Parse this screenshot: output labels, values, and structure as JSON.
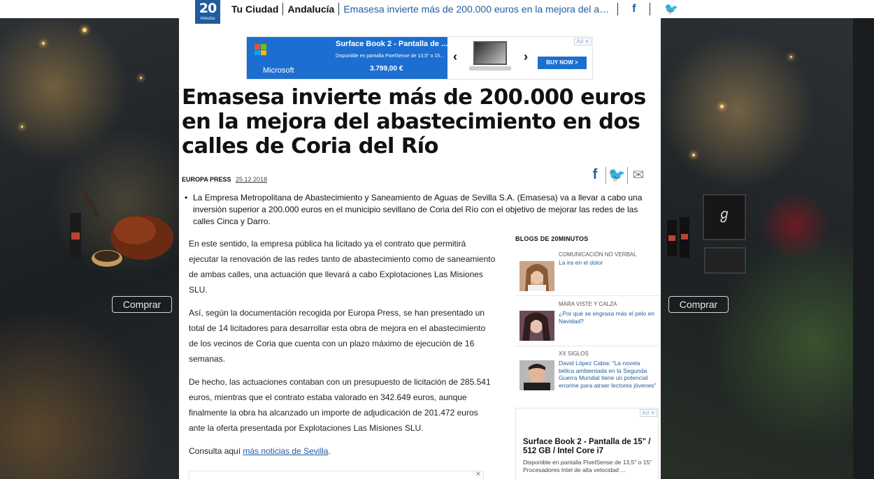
{
  "topbar": {
    "logo_number": "20",
    "logo_word": "minutos",
    "section": "Tu Ciudad",
    "subsection": "Andalucía",
    "article_title_short": "Emasesa invierte más de 200.000 euros en la mejora del a…",
    "facebook_glyph": "f",
    "twitter_glyph": "🐦"
  },
  "top_ad": {
    "brand": "Microsoft",
    "title": "Surface Book 2 - Pantalla de ...",
    "subtitle": "Disponible en pantalla PixelSense de 13,5\" o 15...",
    "price": "3.799,00 €",
    "cta": "BUY NOW >",
    "prev": "‹",
    "next": "›",
    "adchoice": "Ad ✕",
    "colors": {
      "blue": "#1c6fd1"
    }
  },
  "article": {
    "headline": "Emasesa invierte más de 200.000 euros en la mejora del abastecimiento en dos calles de Coria del Río",
    "source": "EUROPA PRESS",
    "date": "25.12.2018",
    "summary": "La Empresa Metropolitana de Abastecimiento y Saneamiento de Aguas de Sevilla S.A. (Emasesa) va a llevar a cabo una inversión superior a 200.000 euros en el municipio sevillano de Coria del Río con el objetivo de mejorar las redes de las calles Cinca y Darro.",
    "bullet": "•",
    "paragraphs": [
      "En este sentido, la empresa pública ha licitado ya el contrato que permitirá ejecutar la renovación de las redes tanto de abastecimiento como de saneamiento de ambas calles, una actuación que llevará a cabo Explotaciones Las Misiones SLU.",
      "Así, según la documentación recogida por Europa Press, se han presentado un total de 14 licitadores para desarrollar esta obra de mejora en el abastecimiento de los vecinos de Coria que cuenta con un plazo máximo de ejecución de 16 semanas.",
      "De hecho, las actuaciones contaban con un presupuesto de licitación de 285.541 euros, mientras que el contrato estaba valorado en 342.649 euros, aunque finalmente la obra ha alcanzado un importe de adjudicación de 201.472 euros ante la oferta presentada por Explotaciones Las Misiones SLU."
    ],
    "more_prefix": "Consulta aquí ",
    "more_link": "más noticias de Sevilla",
    "more_suffix": "."
  },
  "share": {
    "facebook": "f",
    "twitter": "🐦",
    "email": "✉"
  },
  "sidebar": {
    "heading": "BLOGS DE 20MINUTOS",
    "blogs": [
      {
        "category": "COMUNICACIÓN NO VERBAL",
        "title": "La ira en el dolor"
      },
      {
        "category": "MARA VISTE Y CALZA",
        "title": "¿Por qué se engrasa más el pelo en Navidad?"
      },
      {
        "category": "XX SIGLOS",
        "title": "David López Cabia: \"La novela bélica ambientada en la Segunda Guerra Mundial tiene un potencial enorme para atraer lectores jóvenes\""
      }
    ],
    "ad": {
      "adchoice": "Ad ✕",
      "title": "Surface Book 2 - Pantalla de 15\" / 512 GB / Intel Core i7",
      "description": "Disponible en pantalla PixelSense de 13,5\" o 15\" Procesadores Intel de alta velocidad ..."
    }
  },
  "background": {
    "buy_left": "Comprar",
    "buy_right": "Comprar"
  },
  "bottom_ad": {
    "close": "✕"
  }
}
